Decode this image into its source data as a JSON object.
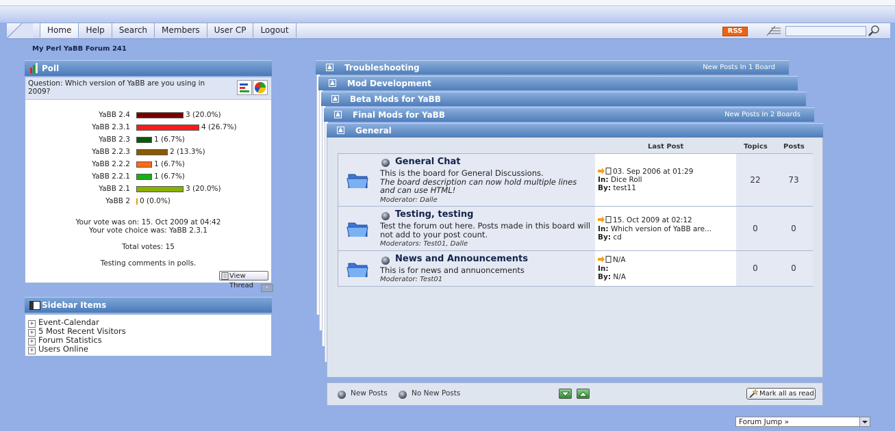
{
  "nav": {
    "tabs": [
      "Home",
      "Help",
      "Search",
      "Members",
      "User CP",
      "Logout"
    ],
    "rss": "RSS",
    "search_value": ""
  },
  "forum_title": "My Perl YaBB Forum 241",
  "poll": {
    "header": "Poll",
    "question": "Question: Which version of YaBB are you using in 2009?",
    "options": [
      {
        "label": "YaBB 2.4",
        "votes": 3,
        "percent": 20.0,
        "value_text": "3 (20.0%)",
        "color": "#7a0000"
      },
      {
        "label": "YaBB 2.3.1",
        "votes": 4,
        "percent": 26.7,
        "value_text": "4 (26.7%)",
        "color": "#ff1a1a"
      },
      {
        "label": "YaBB 2.3",
        "votes": 1,
        "percent": 6.7,
        "value_text": "1 (6.7%)",
        "color": "#0a5a0a"
      },
      {
        "label": "YaBB 2.2.3",
        "votes": 2,
        "percent": 13.3,
        "value_text": "2 (13.3%)",
        "color": "#8a5a00"
      },
      {
        "label": "YaBB 2.2.2",
        "votes": 1,
        "percent": 6.7,
        "value_text": "1 (6.7%)",
        "color": "#ff6a1a"
      },
      {
        "label": "YaBB 2.2.1",
        "votes": 1,
        "percent": 6.7,
        "value_text": "1 (6.7%)",
        "color": "#1ab01a"
      },
      {
        "label": "YaBB 2.1",
        "votes": 3,
        "percent": 20.0,
        "value_text": "3 (20.0%)",
        "color": "#8ab000"
      },
      {
        "label": "YaBB 2",
        "votes": 0,
        "percent": 0.0,
        "value_text": "0 (0.0%)",
        "color": "#e0a000"
      }
    ],
    "vote_on": "Your vote was on: 15. Oct 2009 at 04:42",
    "vote_choice": "Your vote choice was: YaBB 2.3.1",
    "total_votes": "Total votes: 15",
    "comment": "Testing comments in polls.",
    "view_thread": "View Thread"
  },
  "sidebar": {
    "header": "Sidebar Items",
    "items": [
      "Event-Calendar",
      "5 Most Recent Visitors",
      "Forum Statistics",
      "Users Online"
    ]
  },
  "categories": [
    {
      "name": "Troubleshooting",
      "note": "New Posts In 1 Board"
    },
    {
      "name": "Mod Development",
      "note": ""
    },
    {
      "name": "Beta Mods for YaBB",
      "note": ""
    },
    {
      "name": "Final Mods for YaBB",
      "note": "New Posts In 2 Boards"
    },
    {
      "name": "General",
      "note": ""
    }
  ],
  "board_headers": {
    "last_post": "Last Post",
    "topics": "Topics",
    "posts": "Posts"
  },
  "boards": [
    {
      "name": "General Chat",
      "desc": "This is the board for General Discussions.",
      "desc_italic": "The board description can now hold multiple lines and can use HTML!",
      "moderator": "Moderator: Dalle",
      "last_date": "03. Sep 2006 at 01:29",
      "last_in_label": "In:",
      "last_in": "Dice Roll",
      "last_by_label": "By:",
      "last_by": "test11",
      "topics": "22",
      "posts": "73"
    },
    {
      "name": "Testing,  testing",
      "desc": "Test the forum out here. Posts made in this board will not add to your post count.",
      "desc_italic": "",
      "moderator": "Moderators: Test01, Dalle",
      "last_date": "15. Oct 2009 at 02:12",
      "last_in_label": "In:",
      "last_in": "Which version of YaBB are...",
      "last_by_label": "By:",
      "last_by": "cd",
      "topics": "0",
      "posts": "0"
    },
    {
      "name": "News and Announcements",
      "desc": "This is for news and annuoncements",
      "desc_italic": "",
      "moderator": "Moderator: Test01",
      "last_date": "N/A",
      "last_in_label": "In:",
      "last_in": "",
      "last_by_label": "By:",
      "last_by": "N/A",
      "topics": "0",
      "posts": "0"
    }
  ],
  "legend": {
    "new_posts": "New Posts",
    "no_new_posts": "No New Posts"
  },
  "mark_all_read": "Mark all as read",
  "forum_jump": "Forum Jump »"
}
